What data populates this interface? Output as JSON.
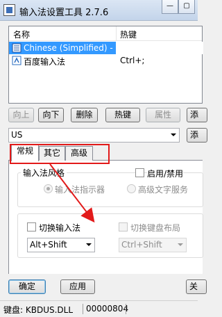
{
  "window": {
    "title": "输入法设置工具 2.7.6",
    "minimize_glyph": "—",
    "maximize_glyph": "▢"
  },
  "list": {
    "columns": [
      "名称",
      "热键"
    ],
    "rows": [
      {
        "name": "Chinese (Simplified) - US...",
        "hotkey": "",
        "icon": "keyboard-icon",
        "selected": true
      },
      {
        "name": "百度输入法",
        "hotkey": "Ctrl+;",
        "icon": "ime-icon",
        "selected": false
      }
    ]
  },
  "toolbar": {
    "up": "向上",
    "down": "向下",
    "delete": "删除",
    "hotkey": "热键",
    "properties": "属性",
    "partial_right": "添"
  },
  "layout_select": {
    "value": "US",
    "partial_right": "添"
  },
  "tabs": {
    "general": "常规",
    "other": "其它",
    "advanced": "高级"
  },
  "style_group": {
    "label": "输入法风格",
    "enable_label": "启用/禁用",
    "option_indicator": "输入法指示器",
    "option_advanced": "高级文字服务"
  },
  "switch_group": {
    "switch_ime_label": "切换输入法",
    "switch_ime_value": "Alt+Shift",
    "switch_kbd_label": "切换键盘布局",
    "switch_kbd_value": "Ctrl+Shift"
  },
  "bottom": {
    "ok": "确定",
    "apply": "应用",
    "partial_right": "关"
  },
  "status": {
    "keyboard": "键盘: KBDUS.DLL",
    "code": "00000804"
  },
  "colors": {
    "selection": "#3399ff",
    "annotation": "#e21a1a"
  }
}
